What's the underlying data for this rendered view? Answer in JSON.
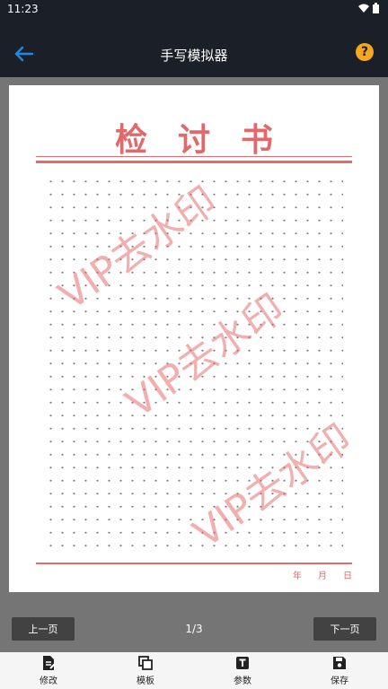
{
  "status": {
    "time": "11:23"
  },
  "appbar": {
    "title": "手写模拟器",
    "help": "?"
  },
  "paper": {
    "title": "检讨书",
    "date_labels": [
      "年",
      "月",
      "日"
    ],
    "watermark": "VIP去水印"
  },
  "pager": {
    "prev_label": "上一页",
    "next_label": "下一页",
    "indicator": "1/3"
  },
  "bottom_nav": [
    {
      "label": "修改",
      "icon": "edit-document-icon"
    },
    {
      "label": "模板",
      "icon": "copy-template-icon"
    },
    {
      "label": "参数",
      "icon": "text-params-icon"
    },
    {
      "label": "保存",
      "icon": "save-icon"
    }
  ],
  "colors": {
    "accent": "#1e88e5",
    "help": "#f5a623",
    "paper_red": "#e46b6b",
    "bar": "#1b1f27"
  }
}
